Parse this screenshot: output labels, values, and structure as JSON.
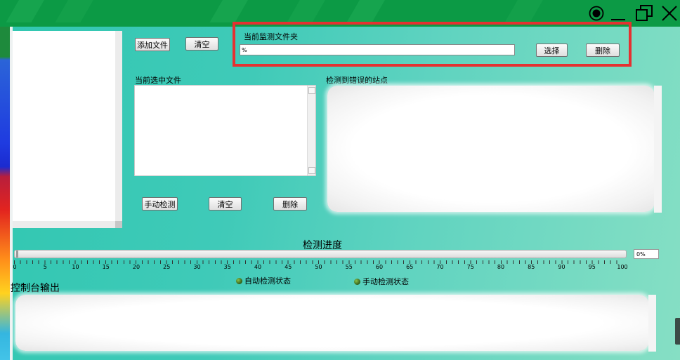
{
  "window": {
    "controls": {
      "record_icon": "record-icon",
      "minimize_icon": "minimize-icon",
      "restore_icon": "restore-icon",
      "close_icon": "close-icon"
    }
  },
  "toolbar": {
    "add_file": "添加文件",
    "clear": "清空"
  },
  "monitor": {
    "title": "当前监测文件夹",
    "path_value": "%",
    "select": "选择",
    "delete": "删除"
  },
  "selected_files": {
    "title": "当前选中文件",
    "manual_check": "手动检测",
    "clear": "清空",
    "delete": "删除"
  },
  "errors": {
    "title": "检测到错误的站点"
  },
  "progress": {
    "title": "检测进度",
    "percent_text": "0%",
    "fraction": 0,
    "scale": [
      "0",
      "5",
      "10",
      "15",
      "20",
      "25",
      "30",
      "35",
      "40",
      "45",
      "50",
      "55",
      "60",
      "65",
      "70",
      "75",
      "80",
      "85",
      "90",
      "95",
      "100"
    ]
  },
  "status": {
    "auto": "自动检测状态",
    "manual": "手动检测状态"
  },
  "console": {
    "title": "控制台输出"
  },
  "colors": {
    "titlebar": "#0c9a45",
    "accent_red": "#e53131",
    "background": "#3fcab8"
  }
}
